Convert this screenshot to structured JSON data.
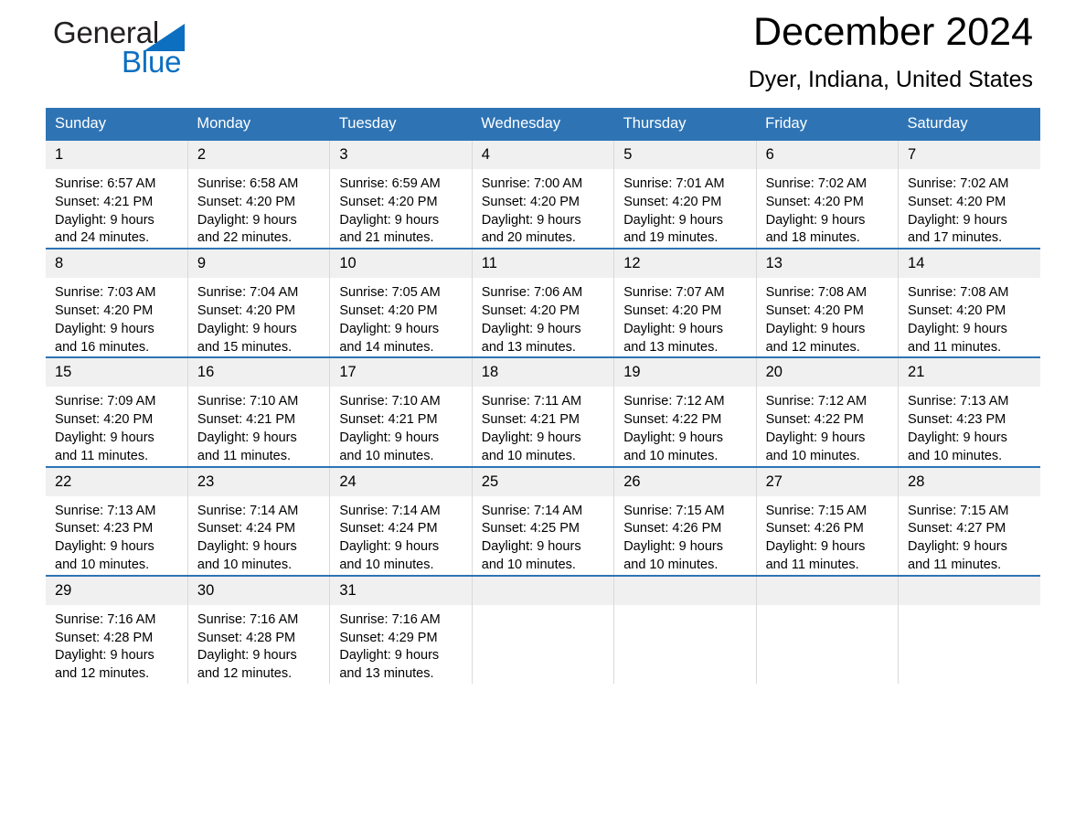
{
  "brand": {
    "name_part1": "General",
    "name_part2": "Blue",
    "triangle_icon": "triangle-icon",
    "accent_color": "#0d6fc0"
  },
  "header": {
    "title": "December 2024",
    "location": "Dyer, Indiana, United States"
  },
  "theme": {
    "header_blue": "#2e74b5",
    "daynum_band": "#f0f0f0",
    "cell_divider": "#d9d9d9"
  },
  "calendar": {
    "weekdays": [
      "Sunday",
      "Monday",
      "Tuesday",
      "Wednesday",
      "Thursday",
      "Friday",
      "Saturday"
    ],
    "weeks": [
      [
        {
          "day": "1",
          "sunrise": "Sunrise: 6:57 AM",
          "sunset": "Sunset: 4:21 PM",
          "daylight1": "Daylight: 9 hours",
          "daylight2": "and 24 minutes."
        },
        {
          "day": "2",
          "sunrise": "Sunrise: 6:58 AM",
          "sunset": "Sunset: 4:20 PM",
          "daylight1": "Daylight: 9 hours",
          "daylight2": "and 22 minutes."
        },
        {
          "day": "3",
          "sunrise": "Sunrise: 6:59 AM",
          "sunset": "Sunset: 4:20 PM",
          "daylight1": "Daylight: 9 hours",
          "daylight2": "and 21 minutes."
        },
        {
          "day": "4",
          "sunrise": "Sunrise: 7:00 AM",
          "sunset": "Sunset: 4:20 PM",
          "daylight1": "Daylight: 9 hours",
          "daylight2": "and 20 minutes."
        },
        {
          "day": "5",
          "sunrise": "Sunrise: 7:01 AM",
          "sunset": "Sunset: 4:20 PM",
          "daylight1": "Daylight: 9 hours",
          "daylight2": "and 19 minutes."
        },
        {
          "day": "6",
          "sunrise": "Sunrise: 7:02 AM",
          "sunset": "Sunset: 4:20 PM",
          "daylight1": "Daylight: 9 hours",
          "daylight2": "and 18 minutes."
        },
        {
          "day": "7",
          "sunrise": "Sunrise: 7:02 AM",
          "sunset": "Sunset: 4:20 PM",
          "daylight1": "Daylight: 9 hours",
          "daylight2": "and 17 minutes."
        }
      ],
      [
        {
          "day": "8",
          "sunrise": "Sunrise: 7:03 AM",
          "sunset": "Sunset: 4:20 PM",
          "daylight1": "Daylight: 9 hours",
          "daylight2": "and 16 minutes."
        },
        {
          "day": "9",
          "sunrise": "Sunrise: 7:04 AM",
          "sunset": "Sunset: 4:20 PM",
          "daylight1": "Daylight: 9 hours",
          "daylight2": "and 15 minutes."
        },
        {
          "day": "10",
          "sunrise": "Sunrise: 7:05 AM",
          "sunset": "Sunset: 4:20 PM",
          "daylight1": "Daylight: 9 hours",
          "daylight2": "and 14 minutes."
        },
        {
          "day": "11",
          "sunrise": "Sunrise: 7:06 AM",
          "sunset": "Sunset: 4:20 PM",
          "daylight1": "Daylight: 9 hours",
          "daylight2": "and 13 minutes."
        },
        {
          "day": "12",
          "sunrise": "Sunrise: 7:07 AM",
          "sunset": "Sunset: 4:20 PM",
          "daylight1": "Daylight: 9 hours",
          "daylight2": "and 13 minutes."
        },
        {
          "day": "13",
          "sunrise": "Sunrise: 7:08 AM",
          "sunset": "Sunset: 4:20 PM",
          "daylight1": "Daylight: 9 hours",
          "daylight2": "and 12 minutes."
        },
        {
          "day": "14",
          "sunrise": "Sunrise: 7:08 AM",
          "sunset": "Sunset: 4:20 PM",
          "daylight1": "Daylight: 9 hours",
          "daylight2": "and 11 minutes."
        }
      ],
      [
        {
          "day": "15",
          "sunrise": "Sunrise: 7:09 AM",
          "sunset": "Sunset: 4:20 PM",
          "daylight1": "Daylight: 9 hours",
          "daylight2": "and 11 minutes."
        },
        {
          "day": "16",
          "sunrise": "Sunrise: 7:10 AM",
          "sunset": "Sunset: 4:21 PM",
          "daylight1": "Daylight: 9 hours",
          "daylight2": "and 11 minutes."
        },
        {
          "day": "17",
          "sunrise": "Sunrise: 7:10 AM",
          "sunset": "Sunset: 4:21 PM",
          "daylight1": "Daylight: 9 hours",
          "daylight2": "and 10 minutes."
        },
        {
          "day": "18",
          "sunrise": "Sunrise: 7:11 AM",
          "sunset": "Sunset: 4:21 PM",
          "daylight1": "Daylight: 9 hours",
          "daylight2": "and 10 minutes."
        },
        {
          "day": "19",
          "sunrise": "Sunrise: 7:12 AM",
          "sunset": "Sunset: 4:22 PM",
          "daylight1": "Daylight: 9 hours",
          "daylight2": "and 10 minutes."
        },
        {
          "day": "20",
          "sunrise": "Sunrise: 7:12 AM",
          "sunset": "Sunset: 4:22 PM",
          "daylight1": "Daylight: 9 hours",
          "daylight2": "and 10 minutes."
        },
        {
          "day": "21",
          "sunrise": "Sunrise: 7:13 AM",
          "sunset": "Sunset: 4:23 PM",
          "daylight1": "Daylight: 9 hours",
          "daylight2": "and 10 minutes."
        }
      ],
      [
        {
          "day": "22",
          "sunrise": "Sunrise: 7:13 AM",
          "sunset": "Sunset: 4:23 PM",
          "daylight1": "Daylight: 9 hours",
          "daylight2": "and 10 minutes."
        },
        {
          "day": "23",
          "sunrise": "Sunrise: 7:14 AM",
          "sunset": "Sunset: 4:24 PM",
          "daylight1": "Daylight: 9 hours",
          "daylight2": "and 10 minutes."
        },
        {
          "day": "24",
          "sunrise": "Sunrise: 7:14 AM",
          "sunset": "Sunset: 4:24 PM",
          "daylight1": "Daylight: 9 hours",
          "daylight2": "and 10 minutes."
        },
        {
          "day": "25",
          "sunrise": "Sunrise: 7:14 AM",
          "sunset": "Sunset: 4:25 PM",
          "daylight1": "Daylight: 9 hours",
          "daylight2": "and 10 minutes."
        },
        {
          "day": "26",
          "sunrise": "Sunrise: 7:15 AM",
          "sunset": "Sunset: 4:26 PM",
          "daylight1": "Daylight: 9 hours",
          "daylight2": "and 10 minutes."
        },
        {
          "day": "27",
          "sunrise": "Sunrise: 7:15 AM",
          "sunset": "Sunset: 4:26 PM",
          "daylight1": "Daylight: 9 hours",
          "daylight2": "and 11 minutes."
        },
        {
          "day": "28",
          "sunrise": "Sunrise: 7:15 AM",
          "sunset": "Sunset: 4:27 PM",
          "daylight1": "Daylight: 9 hours",
          "daylight2": "and 11 minutes."
        }
      ],
      [
        {
          "day": "29",
          "sunrise": "Sunrise: 7:16 AM",
          "sunset": "Sunset: 4:28 PM",
          "daylight1": "Daylight: 9 hours",
          "daylight2": "and 12 minutes."
        },
        {
          "day": "30",
          "sunrise": "Sunrise: 7:16 AM",
          "sunset": "Sunset: 4:28 PM",
          "daylight1": "Daylight: 9 hours",
          "daylight2": "and 12 minutes."
        },
        {
          "day": "31",
          "sunrise": "Sunrise: 7:16 AM",
          "sunset": "Sunset: 4:29 PM",
          "daylight1": "Daylight: 9 hours",
          "daylight2": "and 13 minutes."
        },
        {
          "day": "",
          "sunrise": "",
          "sunset": "",
          "daylight1": "",
          "daylight2": ""
        },
        {
          "day": "",
          "sunrise": "",
          "sunset": "",
          "daylight1": "",
          "daylight2": ""
        },
        {
          "day": "",
          "sunrise": "",
          "sunset": "",
          "daylight1": "",
          "daylight2": ""
        },
        {
          "day": "",
          "sunrise": "",
          "sunset": "",
          "daylight1": "",
          "daylight2": ""
        }
      ]
    ]
  }
}
